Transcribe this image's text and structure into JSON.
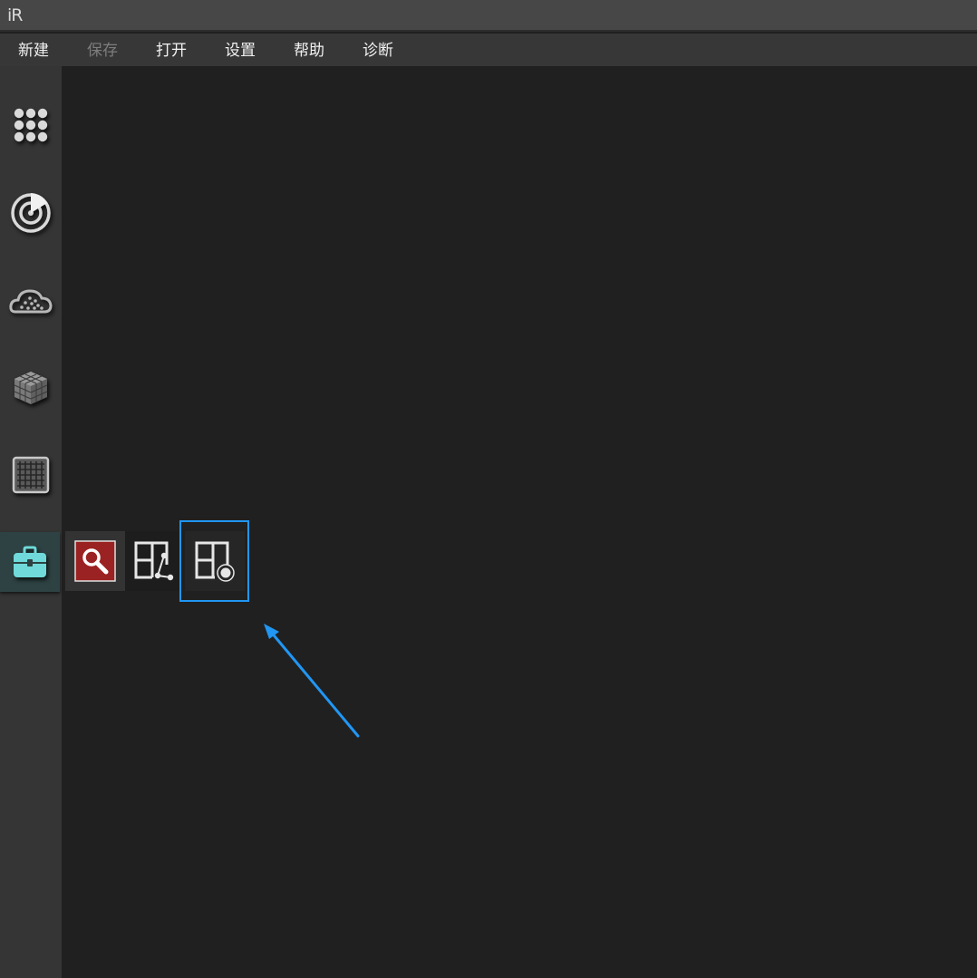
{
  "app": {
    "logo_text": "iR"
  },
  "menu": {
    "items": [
      {
        "label": "新建",
        "enabled": true
      },
      {
        "label": "保存",
        "enabled": false
      },
      {
        "label": "打开",
        "enabled": true
      },
      {
        "label": "设置",
        "enabled": true
      },
      {
        "label": "帮助",
        "enabled": true
      },
      {
        "label": "诊断",
        "enabled": true
      }
    ]
  },
  "sidebar": {
    "items": [
      {
        "icon": "apps-grid-icon",
        "active": false
      },
      {
        "icon": "radar-icon",
        "active": false
      },
      {
        "icon": "point-cloud-icon",
        "active": false
      },
      {
        "icon": "mesh-cube-icon",
        "active": false
      },
      {
        "icon": "grid-table-icon",
        "active": false
      },
      {
        "icon": "toolbox-icon",
        "active": true
      }
    ]
  },
  "flyout": {
    "items": [
      {
        "icon": "search-icon",
        "selected": false
      },
      {
        "icon": "layout-link-icon",
        "selected": false
      },
      {
        "icon": "layout-point-icon",
        "selected": true
      }
    ]
  },
  "colors": {
    "accent_teal": "#6fdad9",
    "search_red": "#9b2222",
    "highlight_blue": "#2196f3",
    "menu_text": "#f2f2f2",
    "menu_disabled": "#7d7d7d"
  }
}
